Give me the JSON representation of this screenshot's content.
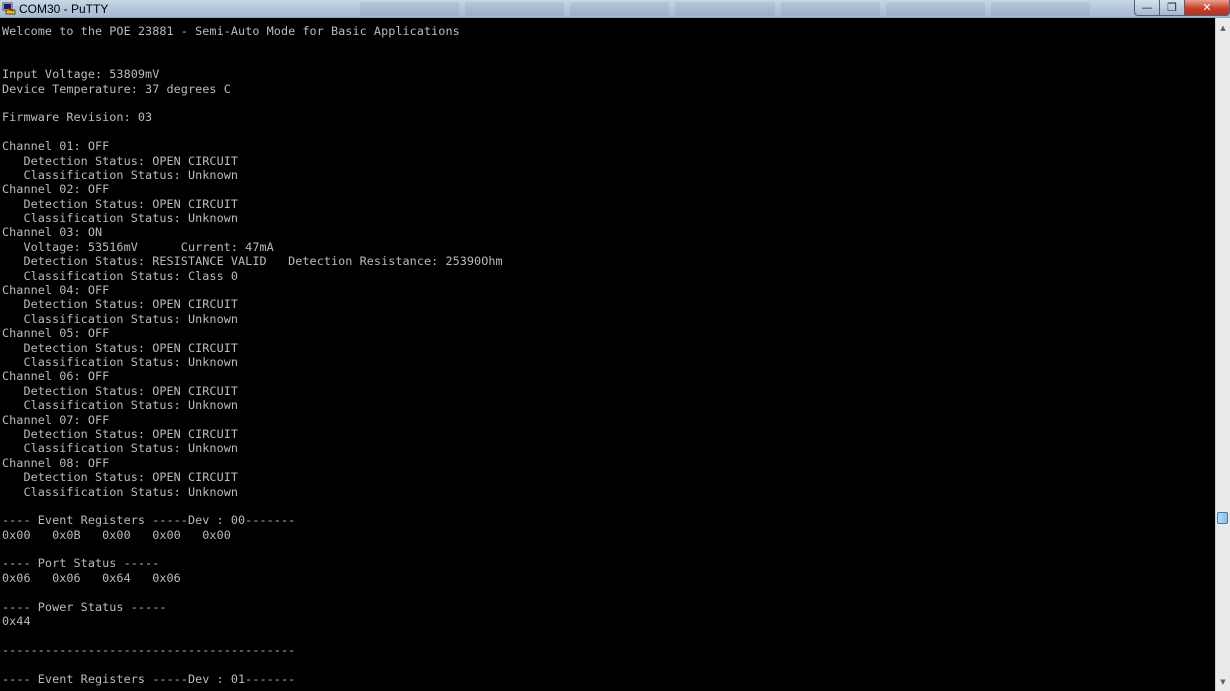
{
  "window": {
    "title": "COM30 - PuTTY",
    "app_icon": "putty-icon",
    "controls": {
      "minimize_glyph": "—",
      "maximize_glyph": "❐",
      "close_glyph": "✕"
    }
  },
  "terminal": {
    "foreground_color": "#bbbbbb",
    "background_color": "#000000",
    "lines": [
      "Welcome to the POE 23881 - Semi-Auto Mode for Basic Applications",
      "",
      "",
      "Input Voltage: 53809mV",
      "Device Temperature: 37 degrees C",
      "",
      "Firmware Revision: 03",
      "",
      "Channel 01: OFF",
      "   Detection Status: OPEN CIRCUIT",
      "   Classification Status: Unknown",
      "Channel 02: OFF",
      "   Detection Status: OPEN CIRCUIT",
      "   Classification Status: Unknown",
      "Channel 03: ON",
      "   Voltage: 53516mV      Current: 47mA",
      "   Detection Status: RESISTANCE VALID   Detection Resistance: 25390Ohm",
      "   Classification Status: Class 0",
      "Channel 04: OFF",
      "   Detection Status: OPEN CIRCUIT",
      "   Classification Status: Unknown",
      "Channel 05: OFF",
      "   Detection Status: OPEN CIRCUIT",
      "   Classification Status: Unknown",
      "Channel 06: OFF",
      "   Detection Status: OPEN CIRCUIT",
      "   Classification Status: Unknown",
      "Channel 07: OFF",
      "   Detection Status: OPEN CIRCUIT",
      "   Classification Status: Unknown",
      "Channel 08: OFF",
      "   Detection Status: OPEN CIRCUIT",
      "   Classification Status: Unknown",
      "",
      "---- Event Registers -----Dev : 00-------",
      "0x00   0x0B   0x00   0x00   0x00",
      "",
      "---- Port Status -----",
      "0x06   0x06   0x64   0x06",
      "",
      "---- Power Status -----",
      "0x44",
      "",
      "-----------------------------------------",
      "",
      "---- Event Registers -----Dev : 01-------"
    ]
  },
  "scrollbar": {
    "up_icon": "scroll-up-arrow-icon",
    "down_icon": "scroll-down-arrow-icon",
    "up_glyph": "▲",
    "down_glyph": "▼"
  }
}
